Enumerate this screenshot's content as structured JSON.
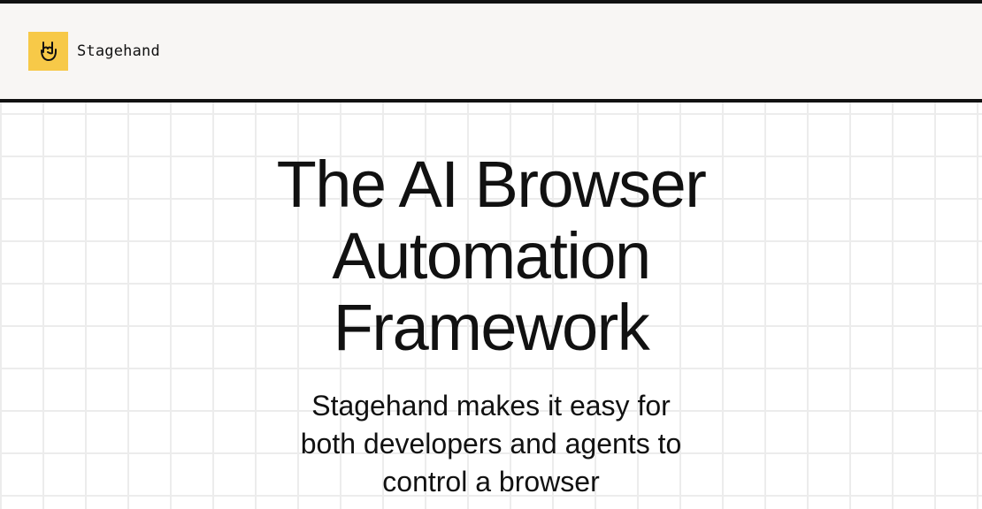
{
  "header": {
    "brand": "Stagehand",
    "logo_icon": "rock-hand-icon"
  },
  "hero": {
    "title_lines": [
      "The AI Browser",
      "Automation",
      "Framework"
    ],
    "subtitle_lines": [
      "Stagehand makes it easy for",
      "both developers and agents to",
      "control a browser"
    ]
  },
  "colors": {
    "accent": "#f7c948",
    "text": "#111111",
    "header_bg": "#f8f6f4",
    "grid": "#ececec"
  }
}
